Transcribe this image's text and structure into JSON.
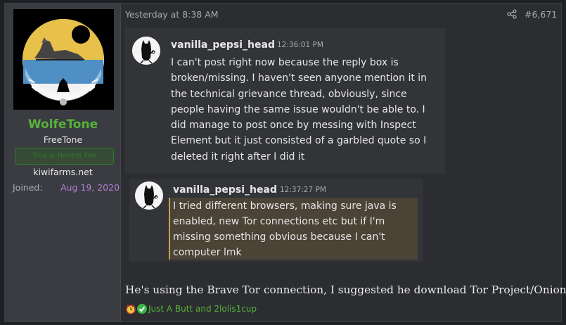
{
  "author": {
    "username": "WolfeTone",
    "user_title": "FreeTone",
    "banner": "True & Honest Fan",
    "website": "kiwifarms.net",
    "joined_label": "Joined:",
    "joined_value": "Aug 19, 2020"
  },
  "post": {
    "timestamp": "Yesterday at 8:38 AM",
    "number": "#6,671",
    "quotes": [
      {
        "author": "vanilla_pepsi_head",
        "time": "12:36:01 PM",
        "text": "I can't post right now because the reply box is broken/missing. I haven't seen anyone mention it in the technical grievance thread, obviously, since people having the same issue wouldn't be able to. I did manage to post once by messing with Inspect Element but it just consisted of a garbled quote so I deleted it right after I did it"
      },
      {
        "author": "vanilla_pepsi_head",
        "time": "12:37:27 PM",
        "text": "I tried different browsers, making sure java is enabled, new Tor connections etc but if I'm missing something obvious because I can't computer lmk"
      }
    ],
    "body": "He's using the Brave Tor connection, I suggested he download Tor Project/Onion",
    "reactions": {
      "icons": [
        "informative-icon",
        "agree-icon"
      ],
      "names": "Just A Butt and 2lolis1cup"
    }
  },
  "colors": {
    "username": "#57b23a",
    "joined": "#b07ed4",
    "quote_highlight_border": "#c8a24a"
  }
}
